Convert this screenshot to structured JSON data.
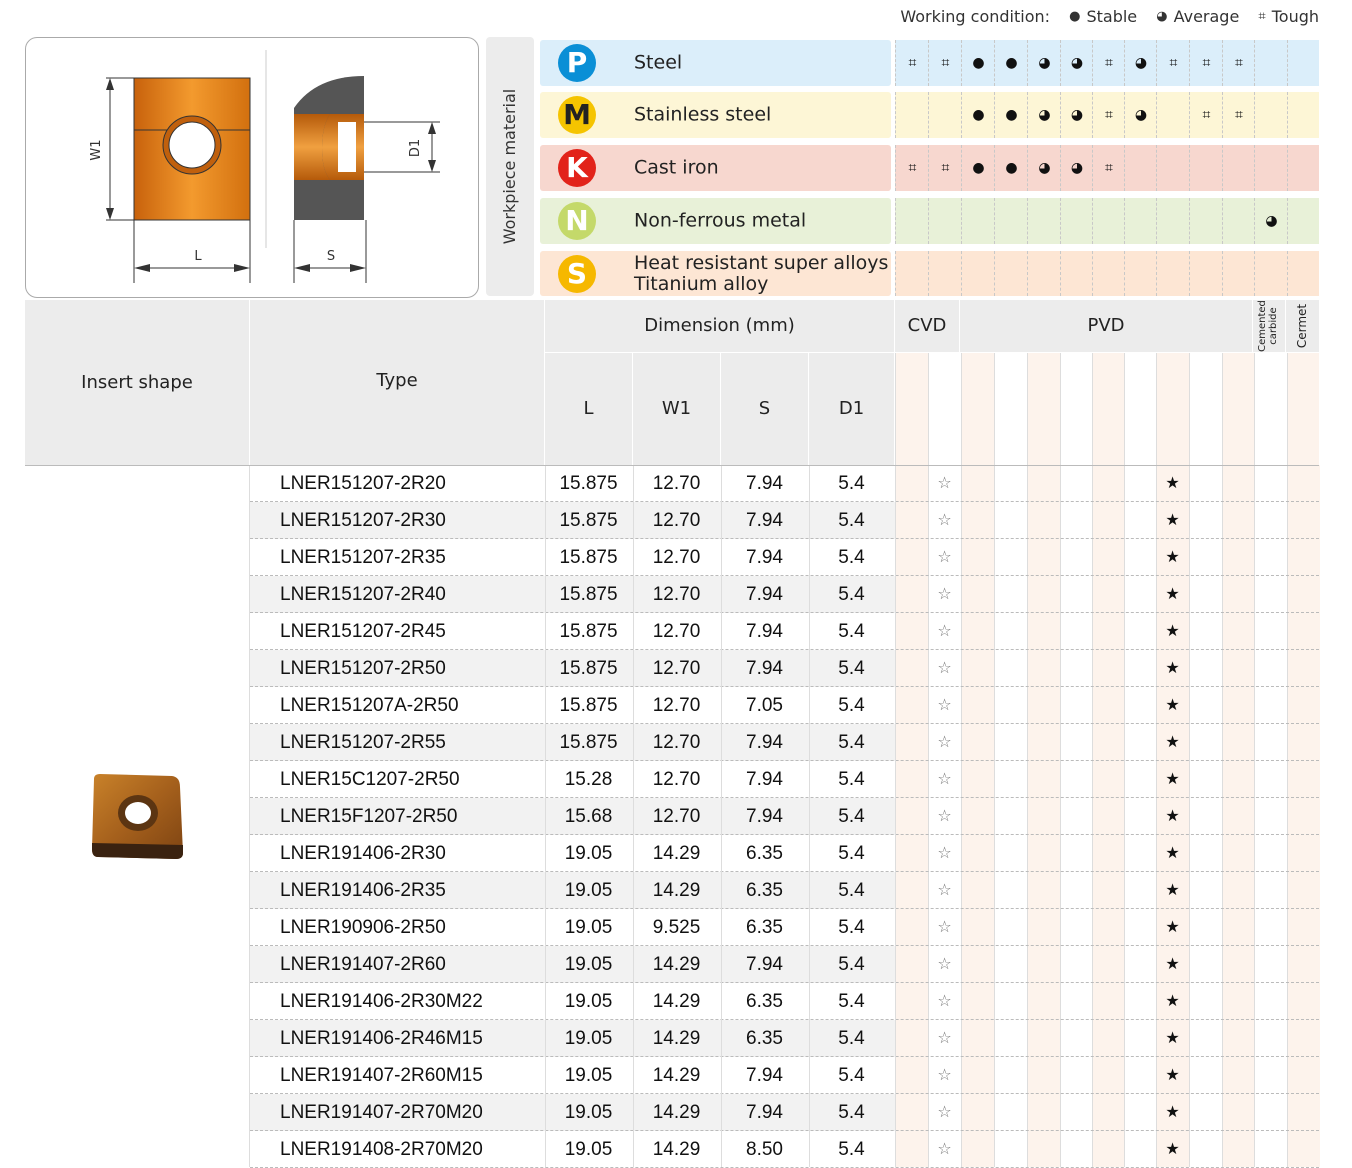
{
  "legend": {
    "title": "Working condition:",
    "stable": "Stable",
    "average": "Average",
    "tough": "Tough",
    "stable_sym": "●",
    "average_sym": "◕",
    "tough_sym": "⌗"
  },
  "drawing": {
    "w1": "W1",
    "l": "L",
    "s": "S",
    "d1": "D1"
  },
  "workpiece_label": "Workpiece material",
  "materials": [
    {
      "letter": "P",
      "name": "Steel",
      "color": "#0a8fd6",
      "bg": "#dbeefa",
      "marks": [
        "⌗",
        "⌗",
        "●",
        "●",
        "◕",
        "◕",
        "⌗",
        "◕",
        "⌗",
        "⌗",
        "⌗",
        "",
        ""
      ]
    },
    {
      "letter": "M",
      "name": "Stainless steel",
      "color": "#f5c400",
      "bg": "#fdf6d6",
      "marks": [
        "",
        "",
        "●",
        "●",
        "◕",
        "◕",
        "⌗",
        "◕",
        "",
        "⌗",
        "⌗",
        "",
        ""
      ]
    },
    {
      "letter": "K",
      "name": "Cast iron",
      "color": "#e2231a",
      "bg": "#f7d7cf",
      "marks": [
        "⌗",
        "⌗",
        "●",
        "●",
        "◕",
        "◕",
        "⌗",
        "",
        "",
        "",
        "",
        "",
        ""
      ]
    },
    {
      "letter": "N",
      "name": "Non-ferrous metal",
      "color": "#c4d96a",
      "bg": "#e8f1d8",
      "marks": [
        "",
        "",
        "",
        "",
        "",
        "",
        "",
        "",
        "",
        "",
        "",
        "◕",
        ""
      ]
    },
    {
      "letter": "S",
      "name": "Heat resistant super alloys\nTitanium alloy",
      "name1": "Heat resistant super alloys",
      "name2": "Titanium alloy",
      "color": "#f6b800",
      "bg": "#fde6d4",
      "marks": [
        "",
        "",
        "",
        "",
        "",
        "",
        "",
        "",
        "",
        "",
        "",
        "",
        ""
      ]
    }
  ],
  "table": {
    "insert_shape": "Insert shape",
    "type": "Type",
    "dimension": "Dimension (mm)",
    "cols": [
      "L",
      "W1",
      "S",
      "D1"
    ],
    "cvd": "CVD",
    "pvd": "PVD",
    "cemented": "Cemented carbide",
    "cermet": "Cermet",
    "rows": [
      {
        "type": "LNER151207-2R20",
        "L": "15.875",
        "W1": "12.70",
        "S": "7.94",
        "D1": "5.4"
      },
      {
        "type": "LNER151207-2R30",
        "L": "15.875",
        "W1": "12.70",
        "S": "7.94",
        "D1": "5.4"
      },
      {
        "type": "LNER151207-2R35",
        "L": "15.875",
        "W1": "12.70",
        "S": "7.94",
        "D1": "5.4"
      },
      {
        "type": "LNER151207-2R40",
        "L": "15.875",
        "W1": "12.70",
        "S": "7.94",
        "D1": "5.4"
      },
      {
        "type": "LNER151207-2R45",
        "L": "15.875",
        "W1": "12.70",
        "S": "7.94",
        "D1": "5.4"
      },
      {
        "type": "LNER151207-2R50",
        "L": "15.875",
        "W1": "12.70",
        "S": "7.94",
        "D1": "5.4"
      },
      {
        "type": "LNER151207A-2R50",
        "L": "15.875",
        "W1": "12.70",
        "S": "7.05",
        "D1": "5.4"
      },
      {
        "type": "LNER151207-2R55",
        "L": "15.875",
        "W1": "12.70",
        "S": "7.94",
        "D1": "5.4"
      },
      {
        "type": "LNER15C1207-2R50",
        "L": "15.28",
        "W1": "12.70",
        "S": "7.94",
        "D1": "5.4"
      },
      {
        "type": "LNER15F1207-2R50",
        "L": "15.68",
        "W1": "12.70",
        "S": "7.94",
        "D1": "5.4"
      },
      {
        "type": "LNER191406-2R30",
        "L": "19.05",
        "W1": "14.29",
        "S": "6.35",
        "D1": "5.4"
      },
      {
        "type": "LNER191406-2R35",
        "L": "19.05",
        "W1": "14.29",
        "S": "6.35",
        "D1": "5.4"
      },
      {
        "type": "LNER190906-2R50",
        "L": "19.05",
        "W1": "9.525",
        "S": "6.35",
        "D1": "5.4"
      },
      {
        "type": "LNER191407-2R60",
        "L": "19.05",
        "W1": "14.29",
        "S": "7.94",
        "D1": "5.4"
      },
      {
        "type": "LNER191406-2R30M22",
        "L": "19.05",
        "W1": "14.29",
        "S": "6.35",
        "D1": "5.4"
      },
      {
        "type": "LNER191406-2R46M15",
        "L": "19.05",
        "W1": "14.29",
        "S": "6.35",
        "D1": "5.4"
      },
      {
        "type": "LNER191407-2R60M15",
        "L": "19.05",
        "W1": "14.29",
        "S": "7.94",
        "D1": "5.4"
      },
      {
        "type": "LNER191407-2R70M20",
        "L": "19.05",
        "W1": "14.29",
        "S": "7.94",
        "D1": "5.4"
      },
      {
        "type": "LNER191408-2R70M20",
        "L": "19.05",
        "W1": "14.29",
        "S": "8.50",
        "D1": "5.4"
      }
    ],
    "star_hollow": "☆",
    "star_filled": "★"
  }
}
